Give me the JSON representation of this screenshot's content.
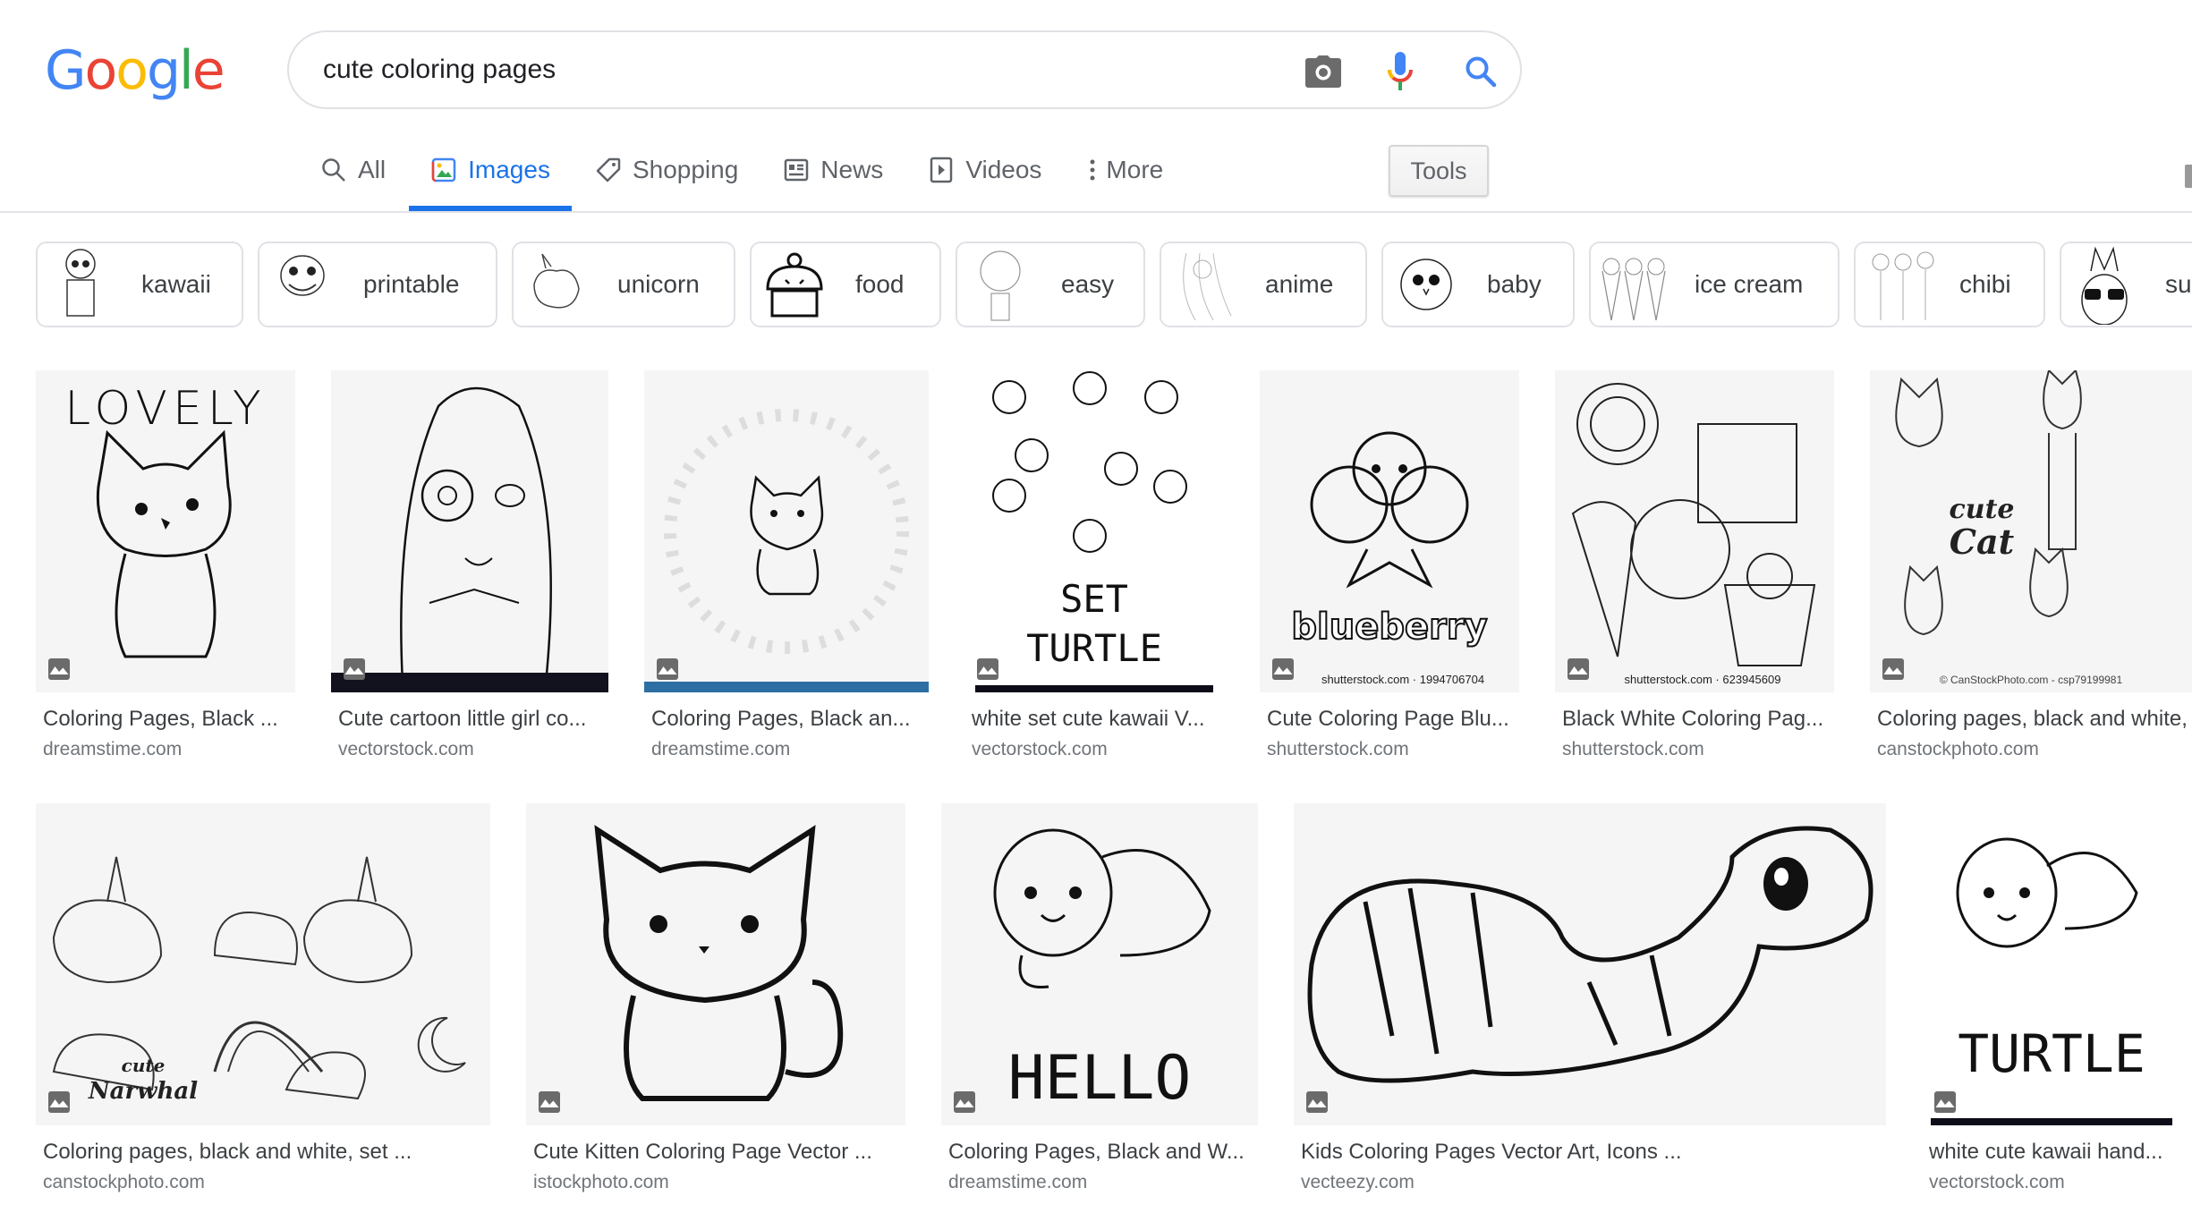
{
  "search": {
    "query": "cute coloring pages",
    "icons": [
      "camera-icon",
      "microphone-icon",
      "search-icon"
    ]
  },
  "logo": {
    "letters": [
      "G",
      "o",
      "o",
      "g",
      "l",
      "e"
    ],
    "colors": [
      "#4285f4",
      "#ea4335",
      "#fbbc05",
      "#4285f4",
      "#34a853",
      "#ea4335"
    ]
  },
  "tabs": [
    {
      "label": "All",
      "icon": "search-icon",
      "active": false
    },
    {
      "label": "Images",
      "icon": "image-icon",
      "active": true
    },
    {
      "label": "Shopping",
      "icon": "tag-icon",
      "active": false
    },
    {
      "label": "News",
      "icon": "newspaper-icon",
      "active": false
    },
    {
      "label": "Videos",
      "icon": "play-icon",
      "active": false
    },
    {
      "label": "More",
      "icon": "more-vert-icon",
      "active": false
    }
  ],
  "tools_label": "Tools",
  "colors": {
    "accent": "#1a73e8",
    "text": "#3c4043",
    "muted": "#70757a",
    "border": "#dfe1e5"
  },
  "chips": [
    {
      "label": "kawaii"
    },
    {
      "label": "printable"
    },
    {
      "label": "unicorn"
    },
    {
      "label": "food"
    },
    {
      "label": "easy"
    },
    {
      "label": "anime"
    },
    {
      "label": "baby"
    },
    {
      "label": "ice cream"
    },
    {
      "label": "chibi"
    },
    {
      "label": "su"
    }
  ],
  "results_row1": [
    {
      "title": "Coloring Pages, Black ...",
      "domain": "dreamstime.com",
      "art_text": "LOVELY"
    },
    {
      "title": "Cute cartoon little girl co...",
      "domain": "vectorstock.com",
      "art_text": ""
    },
    {
      "title": "Coloring Pages, Black an...",
      "domain": "dreamstime.com",
      "art_text": ""
    },
    {
      "title": "white set cute kawaii V...",
      "domain": "vectorstock.com",
      "art_text": "SET TURTLE"
    },
    {
      "title": "Cute Coloring Page Blu...",
      "domain": "shutterstock.com",
      "art_text": "blueberry",
      "watermark": "shutterstock.com · 1994706704"
    },
    {
      "title": "Black White Coloring Pag...",
      "domain": "shutterstock.com",
      "art_text": "",
      "watermark": "shutterstock.com · 623945609"
    },
    {
      "title": "Coloring pages, black and white,",
      "domain": "canstockphoto.com",
      "art_text": "cute Cat",
      "watermark": "© CanStockPhoto.com - csp79199981"
    }
  ],
  "results_row2": [
    {
      "title": "Coloring pages, black and white, set ...",
      "domain": "canstockphoto.com",
      "art_text": "cute Narwhal"
    },
    {
      "title": "Cute Kitten Coloring Page Vector ...",
      "domain": "istockphoto.com",
      "art_text": ""
    },
    {
      "title": "Coloring Pages, Black and W...",
      "domain": "dreamstime.com",
      "art_text": "HELLO"
    },
    {
      "title": "Kids Coloring Pages Vector Art, Icons ...",
      "domain": "vecteezy.com",
      "art_text": ""
    },
    {
      "title": "white cute kawaii hand...",
      "domain": "vectorstock.com",
      "art_text": "TURTLE"
    }
  ]
}
